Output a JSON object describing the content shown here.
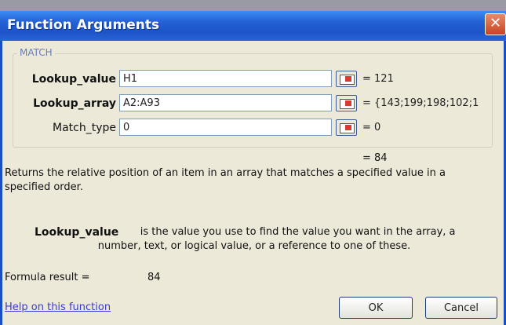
{
  "window": {
    "title": "Function Arguments",
    "close_glyph": "✕"
  },
  "function_group": {
    "name": "MATCH",
    "arguments": [
      {
        "label": "Lookup_value",
        "value": "H1",
        "result": "= 121"
      },
      {
        "label": "Lookup_array",
        "value": "A2:A93",
        "result": "= {143;199;198;102;1"
      },
      {
        "label": "Match_type",
        "value": "0",
        "result": "= 0"
      }
    ]
  },
  "overall_result": "= 84",
  "description": "Returns the relative position of an item in an array that matches a specified value in a specified order.",
  "arg_help": {
    "name": "Lookup_value",
    "text": "is the value you use to find the value you want in the array, a number, text, or logical value, or a reference to one of these."
  },
  "formula_result": {
    "label": "Formula result =",
    "value": "84"
  },
  "help_link": "Help on this function",
  "buttons": {
    "ok": "OK",
    "cancel": "Cancel"
  },
  "icons": {
    "close": "close-icon",
    "range_collapse": "collapse-range-icon"
  },
  "colors": {
    "titlebar": "#2462d6",
    "dialog_bg": "#ece9d8",
    "link": "#3a3ad6"
  }
}
